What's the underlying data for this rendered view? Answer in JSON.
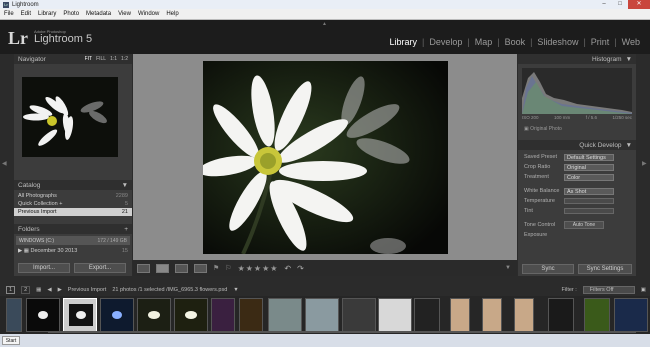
{
  "window": {
    "title": "Lightroom"
  },
  "menu": [
    "File",
    "Edit",
    "Library",
    "Photo",
    "Metadata",
    "View",
    "Window",
    "Help"
  ],
  "identity": {
    "logo": "Lr",
    "small": "Adobe Photoshop",
    "name": "Lightroom 5"
  },
  "modules": [
    "Library",
    "Develop",
    "Map",
    "Book",
    "Slideshow",
    "Print",
    "Web"
  ],
  "left": {
    "navigator": {
      "title": "Navigator",
      "zoom": [
        "FIT",
        "FILL",
        "1:1",
        "1:2"
      ]
    },
    "catalog": {
      "title": "Catalog",
      "items": [
        {
          "label": "All Photographs",
          "count": "2289"
        },
        {
          "label": "Quick Collection +",
          "count": "5"
        },
        {
          "label": "Previous Import",
          "count": "21"
        }
      ]
    },
    "folders": {
      "title": "Folders",
      "volume": "WINDOWS (C:)",
      "volume_info": "172 / 149 GB",
      "folder": "December 30 2013",
      "folder_count": "15"
    },
    "import_label": "Import...",
    "export_label": "Export..."
  },
  "right": {
    "histogram": {
      "title": "Histogram",
      "info": [
        "ISO 200",
        "100 mm",
        "f / 5.6",
        "1/250 sec"
      ],
      "original": "Original Photo"
    },
    "quick_develop": {
      "title": "Quick Develop",
      "saved_preset": {
        "label": "Saved Preset",
        "value": "Default Settings"
      },
      "crop_ratio": {
        "label": "Crop Ratio",
        "value": "Original"
      },
      "treatment": {
        "label": "Treatment",
        "value": "Color"
      },
      "white_balance": {
        "label": "White Balance",
        "value": "As Shot"
      },
      "temperature": "Temperature",
      "tint": "Tint",
      "tone_control": "Tone Control",
      "auto_tone": "Auto Tone",
      "exposure": "Exposure"
    },
    "sync_label": "Sync",
    "sync_settings_label": "Sync Settings"
  },
  "filmstrip": {
    "page1": "1",
    "page2": "2",
    "source": "Previous Import",
    "info": "21 photos /1 selected /IMG_6965.3 flowers.psd",
    "filter_label": "Filter :",
    "filter_value": "Filters Off"
  },
  "taskbar": {
    "start": "Start"
  },
  "colors": {
    "accent": "#ffffff",
    "panel": "#3c3c3c",
    "center": "#8c8c8c"
  }
}
